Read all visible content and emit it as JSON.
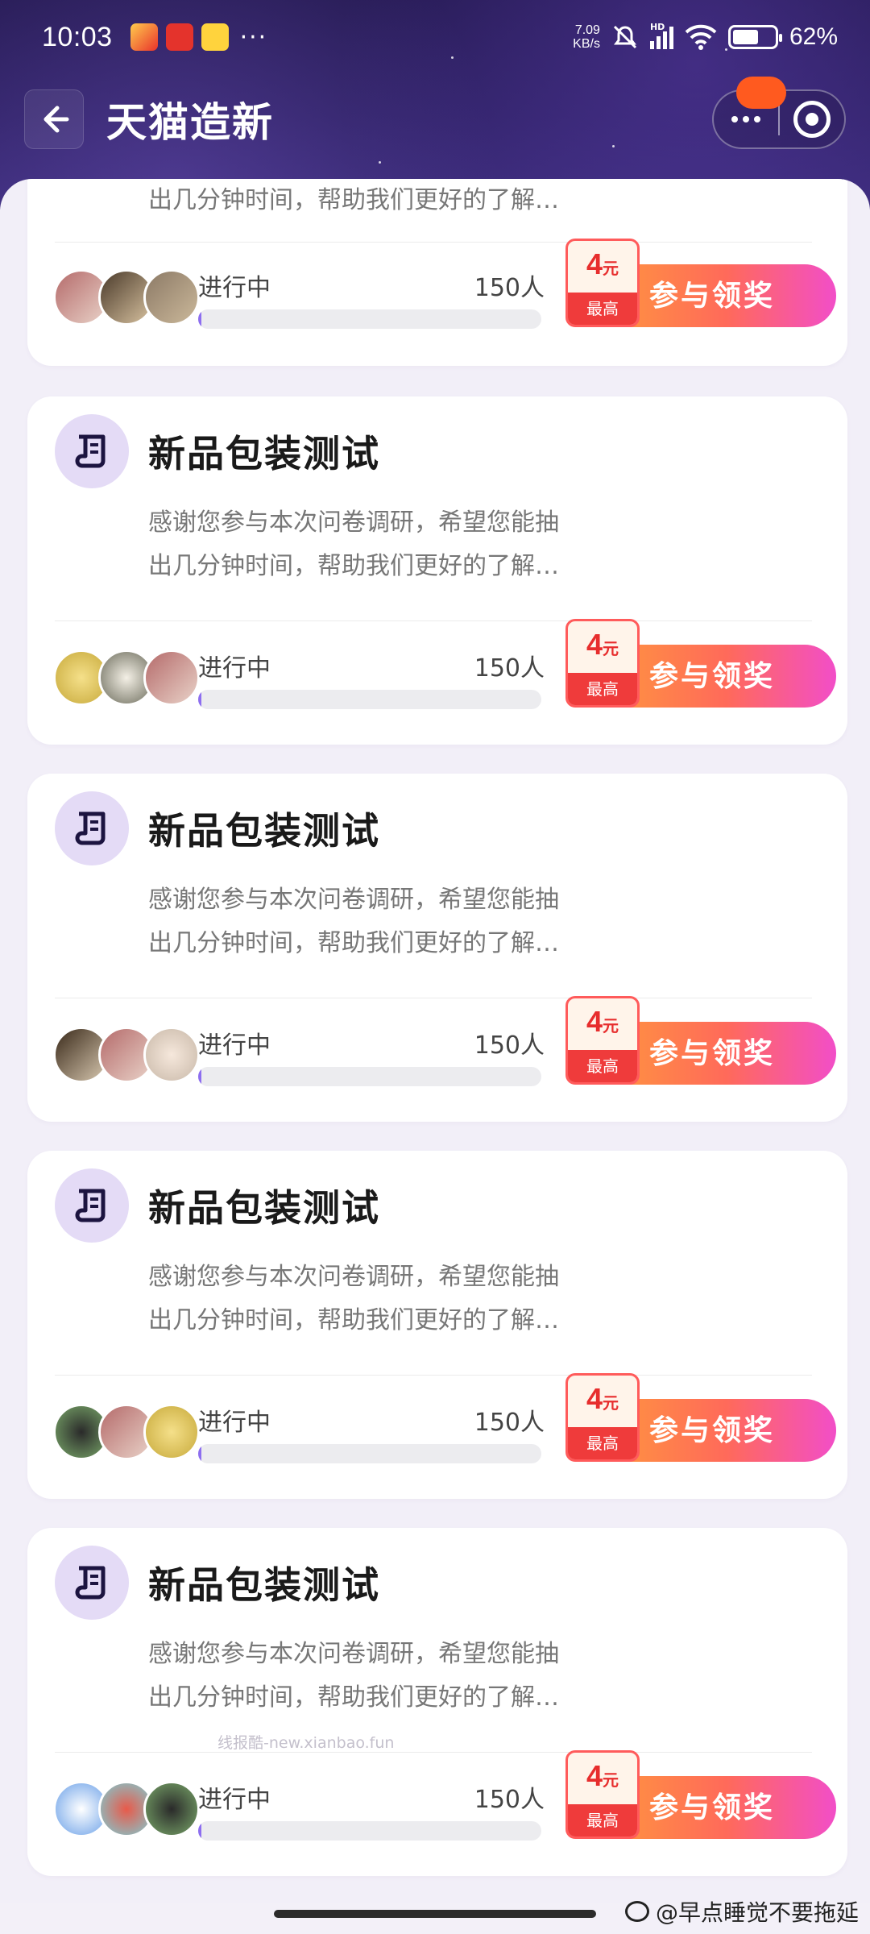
{
  "status_bar": {
    "time": "10:03",
    "more": "···",
    "net_speed_value": "7.09",
    "net_speed_unit": "KB/s",
    "signal_label": "HD",
    "battery_percent": "62%",
    "battery_level": 0.62
  },
  "header": {
    "title": "天猫造新"
  },
  "cards": [
    {
      "title": "",
      "desc_line1": "",
      "desc_line2": "出几分钟时间，帮助我们更好的了解…",
      "status": "进行中",
      "count": "150人",
      "progress": 0.01,
      "reward_amount": "4",
      "reward_unit": "元",
      "reward_max": "最高",
      "cta": "参与领奖"
    },
    {
      "title": "新品包装测试",
      "desc_line1": "感谢您参与本次问卷调研，希望您能抽",
      "desc_line2": "出几分钟时间，帮助我们更好的了解…",
      "status": "进行中",
      "count": "150人",
      "progress": 0.01,
      "reward_amount": "4",
      "reward_unit": "元",
      "reward_max": "最高",
      "cta": "参与领奖"
    },
    {
      "title": "新品包装测试",
      "desc_line1": "感谢您参与本次问卷调研，希望您能抽",
      "desc_line2": "出几分钟时间，帮助我们更好的了解…",
      "status": "进行中",
      "count": "150人",
      "progress": 0.01,
      "reward_amount": "4",
      "reward_unit": "元",
      "reward_max": "最高",
      "cta": "参与领奖"
    },
    {
      "title": "新品包装测试",
      "desc_line1": "感谢您参与本次问卷调研，希望您能抽",
      "desc_line2": "出几分钟时间，帮助我们更好的了解…",
      "status": "进行中",
      "count": "150人",
      "progress": 0.01,
      "reward_amount": "4",
      "reward_unit": "元",
      "reward_max": "最高",
      "cta": "参与领奖"
    },
    {
      "title": "新品包装测试",
      "desc_line1": "感谢您参与本次问卷调研，希望您能抽",
      "desc_line2": "出几分钟时间，帮助我们更好的了解…",
      "status": "进行中",
      "count": "150人",
      "progress": 0.01,
      "reward_amount": "4",
      "reward_unit": "元",
      "reward_max": "最高",
      "cta": "参与领奖"
    }
  ],
  "watermark": "线报酷-new.xianbao.fun",
  "credit": "@早点睡觉不要拖延",
  "colors": {
    "accent_purple": "#8d6ef0",
    "cta_gradient_start": "#ff9a3c",
    "cta_gradient_end": "#f24ec8",
    "reward_red": "#ef3b3b"
  }
}
